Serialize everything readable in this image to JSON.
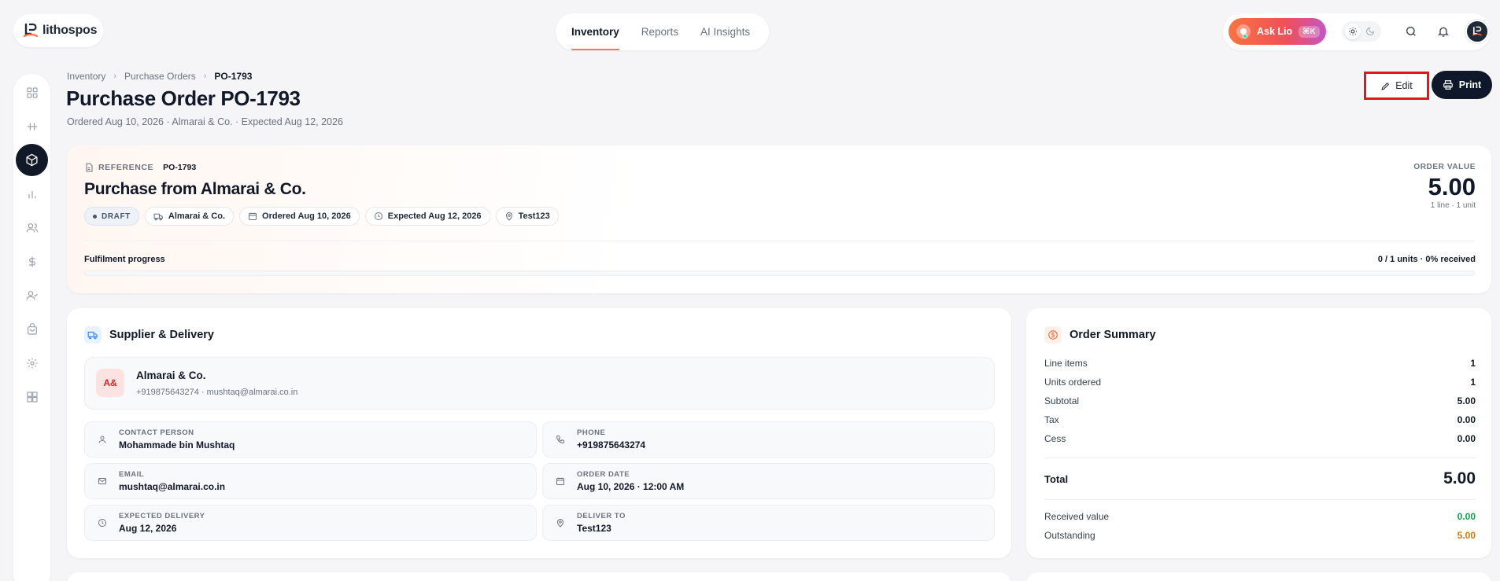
{
  "app": {
    "logo_text": "lithospos"
  },
  "topnav": {
    "tabs": [
      {
        "label": "Inventory",
        "active": true
      },
      {
        "label": "Reports",
        "active": false
      },
      {
        "label": "AI Insights",
        "active": false
      }
    ]
  },
  "header_actions": {
    "ask_label": "Ask Lio",
    "ask_badge": "⌘K",
    "accent_gradient": [
      "#f97341",
      "#ef4f5a",
      "#c356c7"
    ]
  },
  "sidebar": {
    "items": [
      {
        "icon": "grid-icon",
        "active": false
      },
      {
        "icon": "pos-icon",
        "active": false
      },
      {
        "icon": "box-icon",
        "active": true
      },
      {
        "icon": "bar-chart-icon",
        "active": false
      },
      {
        "icon": "users-icon",
        "active": false
      },
      {
        "icon": "dollar-icon",
        "active": false
      },
      {
        "icon": "user-check-icon",
        "active": false
      },
      {
        "icon": "shopping-bag-icon",
        "active": false
      },
      {
        "icon": "gear-icon",
        "active": false
      },
      {
        "icon": "apps-icon",
        "active": false
      }
    ]
  },
  "breadcrumb": [
    "Inventory",
    "Purchase Orders",
    "PO-1793"
  ],
  "page": {
    "title": "Purchase Order PO-1793",
    "subtitle": "Ordered Aug 10, 2026 · Almarai & Co. · Expected Aug 12, 2026",
    "edit_label": "Edit",
    "print_label": "Print"
  },
  "hero": {
    "reference_label": "REFERENCE",
    "reference_value": "PO-1793",
    "title": "Purchase from Almarai & Co.",
    "chips": {
      "status": "DRAFT",
      "supplier": "Almarai & Co.",
      "ordered": "Ordered Aug 10, 2026",
      "expected": "Expected Aug 12, 2026",
      "location": "Test123"
    },
    "order_value_label": "ORDER VALUE",
    "order_value": "5.00",
    "order_value_sub": "1 line · 1 unit",
    "fulfilment_label": "Fulfilment progress",
    "fulfilment_value": "0 / 1 units · 0% received",
    "fulfilment_fraction": 0
  },
  "supplier": {
    "heading": "Supplier & Delivery",
    "initials": "A&",
    "name": "Almarai & Co.",
    "meta": "+919875643274 · mushtaq@almarai.co.in",
    "fields": {
      "contact_label": "CONTACT PERSON",
      "contact_value": "Mohammade bin Mushtaq",
      "phone_label": "PHONE",
      "phone_value": "+919875643274",
      "email_label": "EMAIL",
      "email_value": "mushtaq@almarai.co.in",
      "order_date_label": "ORDER DATE",
      "order_date_value": "Aug 10, 2026 · 12:00 AM",
      "expected_label": "EXPECTED DELIVERY",
      "expected_value": "Aug 12, 2026",
      "deliver_label": "DELIVER TO",
      "deliver_value": "Test123"
    }
  },
  "summary": {
    "heading": "Order Summary",
    "rows": [
      {
        "k": "Line items",
        "v": "1"
      },
      {
        "k": "Units ordered",
        "v": "1"
      },
      {
        "k": "Subtotal",
        "v": "5.00"
      },
      {
        "k": "Tax",
        "v": "0.00"
      },
      {
        "k": "Cess",
        "v": "0.00"
      }
    ],
    "total_label": "Total",
    "total_value": "5.00",
    "received_label": "Received value",
    "received_value": "0.00",
    "received_color": "#16a34a",
    "outstanding_label": "Outstanding",
    "outstanding_value": "5.00",
    "outstanding_color": "#d97706"
  }
}
